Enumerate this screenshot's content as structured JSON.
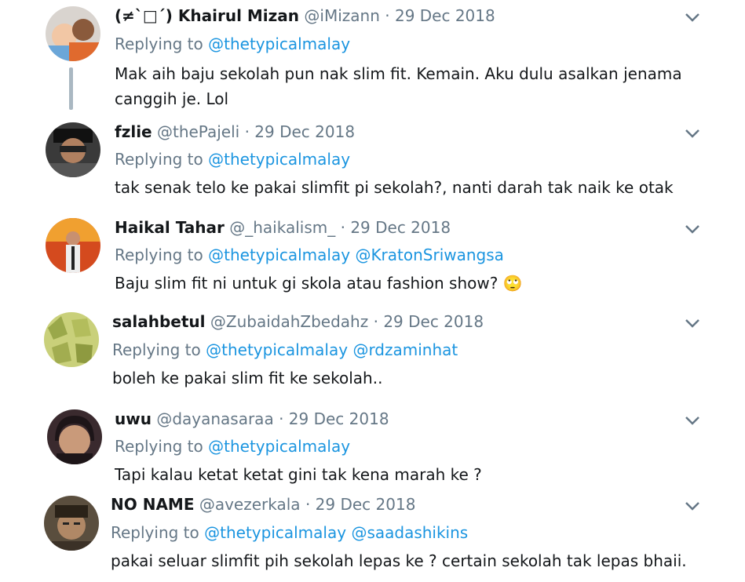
{
  "tweets": [
    {
      "name": "(≠`□´) Khairul Mizan",
      "handle": "@iMizann",
      "dot": "·",
      "date": "29 Dec 2018",
      "replying": "Replying to",
      "mentions": [
        "@thetypicalmalay"
      ],
      "text": "Mak aih baju sekolah pun nak slim fit. Kemain. Aku dulu asalkan jenama canggih je. Lol"
    },
    {
      "name": "fzlie",
      "handle": "@thePajeli",
      "dot": "·",
      "date": "29 Dec 2018",
      "replying": "Replying to",
      "mentions": [
        "@thetypicalmalay"
      ],
      "text": "tak senak telo ke pakai slimfit pi sekolah?, nanti darah tak naik ke otak"
    },
    {
      "name": "Haikal Tahar",
      "handle": "@_haikalism_",
      "dot": "·",
      "date": "29 Dec 2018",
      "replying": "Replying to",
      "mentions": [
        "@thetypicalmalay",
        "@KratonSriwangsa"
      ],
      "text": "Baju slim fit ni untuk gi skola atau fashion show?",
      "emoji": "🙄"
    },
    {
      "name": "salahbetul",
      "handle": "@ZubaidahZbedahz",
      "dot": "·",
      "date": "29 Dec 2018",
      "replying": "Replying to",
      "mentions": [
        "@thetypicalmalay",
        "@rdzaminhat"
      ],
      "text": "boleh ke pakai slim fit ke sekolah.."
    },
    {
      "name": "uwu",
      "handle": "@dayanasaraa",
      "dot": "·",
      "date": "29 Dec 2018",
      "replying": "Replying to",
      "mentions": [
        "@thetypicalmalay"
      ],
      "text": "Tapi kalau ketat ketat gini tak kena marah ke ?"
    },
    {
      "name": "NO NAME",
      "handle": "@avezerkala",
      "dot": "·",
      "date": "29 Dec 2018",
      "replying": "Replying to",
      "mentions": [
        "@thetypicalmalay",
        "@saadashikins"
      ],
      "text": "pakai seluar slimfit pih sekolah lepas ke ? certain sekolah tak lepas bhaii."
    }
  ],
  "icons": {
    "chevron": "chevron-down-icon",
    "avatar": "avatar"
  },
  "colors": {
    "link": "#1b95e0",
    "muted": "#657786",
    "text": "#14171a",
    "thread": "#aab8c2"
  }
}
